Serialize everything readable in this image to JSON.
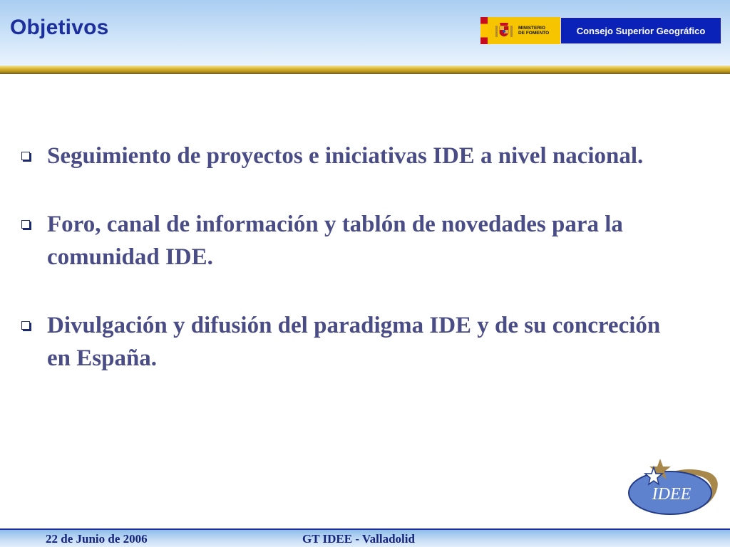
{
  "header": {
    "title": "Objetivos",
    "ministry_text": "MINISTERIO\nDE FOMENTO",
    "organization": "Consejo Superior Geográfico"
  },
  "content": {
    "bullets": [
      "Seguimiento de proyectos e iniciativas IDE a nivel nacional.",
      "Foro, canal de información y tablón de novedades para la comunidad IDE.",
      "Divulgación y difusión del paradigma IDE y de su concreción en España."
    ]
  },
  "logo": {
    "text": "IDEE"
  },
  "footer": {
    "date": "22 de Junio de 2006",
    "event": "GT IDEE - Valladolid"
  },
  "colors": {
    "title": "#1c2f9c",
    "bullet_text": "#4a4c86",
    "csg_background": "#0a22b8",
    "gold_band": "#d8b52e"
  }
}
